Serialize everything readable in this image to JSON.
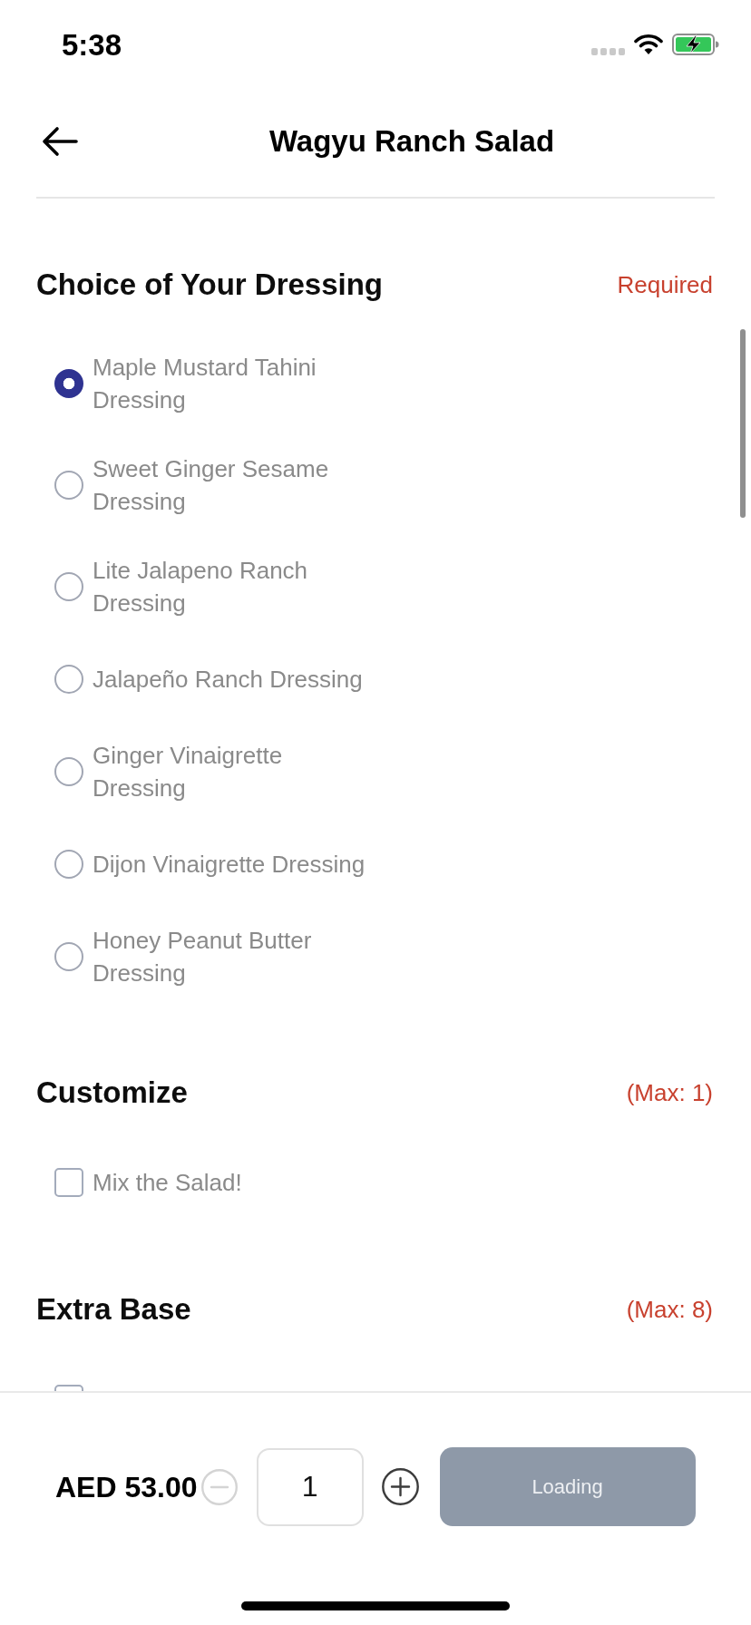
{
  "status_bar": {
    "time": "5:38"
  },
  "header": {
    "title": "Wagyu Ranch Salad"
  },
  "sections": [
    {
      "title": "Choice of Your Dressing",
      "note": "Required",
      "kind": "radio",
      "options": [
        {
          "label": "Maple Mustard Tahini Dressing",
          "selected": true
        },
        {
          "label": "Sweet Ginger Sesame Dressing",
          "selected": false
        },
        {
          "label": "Lite Jalapeno Ranch Dressing",
          "selected": false
        },
        {
          "label": "Jalapeño Ranch Dressing",
          "selected": false
        },
        {
          "label": "Ginger Vinaigrette Dressing",
          "selected": false
        },
        {
          "label": "Dijon Vinaigrette Dressing",
          "selected": false
        },
        {
          "label": "Honey Peanut Butter Dressing",
          "selected": false
        }
      ]
    },
    {
      "title": "Customize",
      "note": "(Max: 1)",
      "kind": "checkbox",
      "options": [
        {
          "label": "Mix the Salad!",
          "checked": false
        }
      ]
    },
    {
      "title": "Extra Base",
      "note": "(Max: 8)",
      "kind": "checkbox",
      "options": [
        {
          "checked": false
        }
      ]
    }
  ],
  "footer": {
    "price": "AED 53.00",
    "quantity": "1",
    "minus_disabled": true,
    "button": {
      "label": "Loading",
      "disabled": true
    }
  }
}
